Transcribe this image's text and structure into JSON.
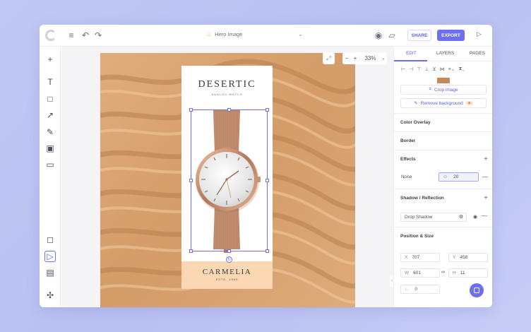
{
  "topbar": {
    "doc_title": "Hero Image",
    "share_label": "SHARE",
    "export_label": "EXPORT"
  },
  "canvas": {
    "zoom": "33%",
    "card": {
      "brand": "DESERTIC",
      "subtitle": "ANALOG WATCH",
      "brand2": "CARMELIA",
      "brand2_sub": "ESTD. 1989"
    }
  },
  "panel": {
    "tabs": [
      "EDIT",
      "LAYERS",
      "PAGES"
    ],
    "crop_label": "Crop image",
    "remove_bg_label": "Remove background",
    "sections": {
      "color_overlay": "Color Overlay",
      "border": "Border",
      "effects": "Effects",
      "shadow": "Shadow / Reflection",
      "position": "Position & Size"
    },
    "noise_label": "Noise",
    "noise_value": "20",
    "shadow_type": "Drop Shadow",
    "x_label": "X",
    "x_value": "707",
    "y_label": "Y",
    "y_value": "458",
    "w_label": "W",
    "w_value": "601",
    "h_label": "H",
    "h_value": "11",
    "angle_value": "0"
  },
  "colors": {
    "accent": "#6c6ff0",
    "sand": "#d8a472",
    "card_bottom": "#fcd7b4"
  }
}
